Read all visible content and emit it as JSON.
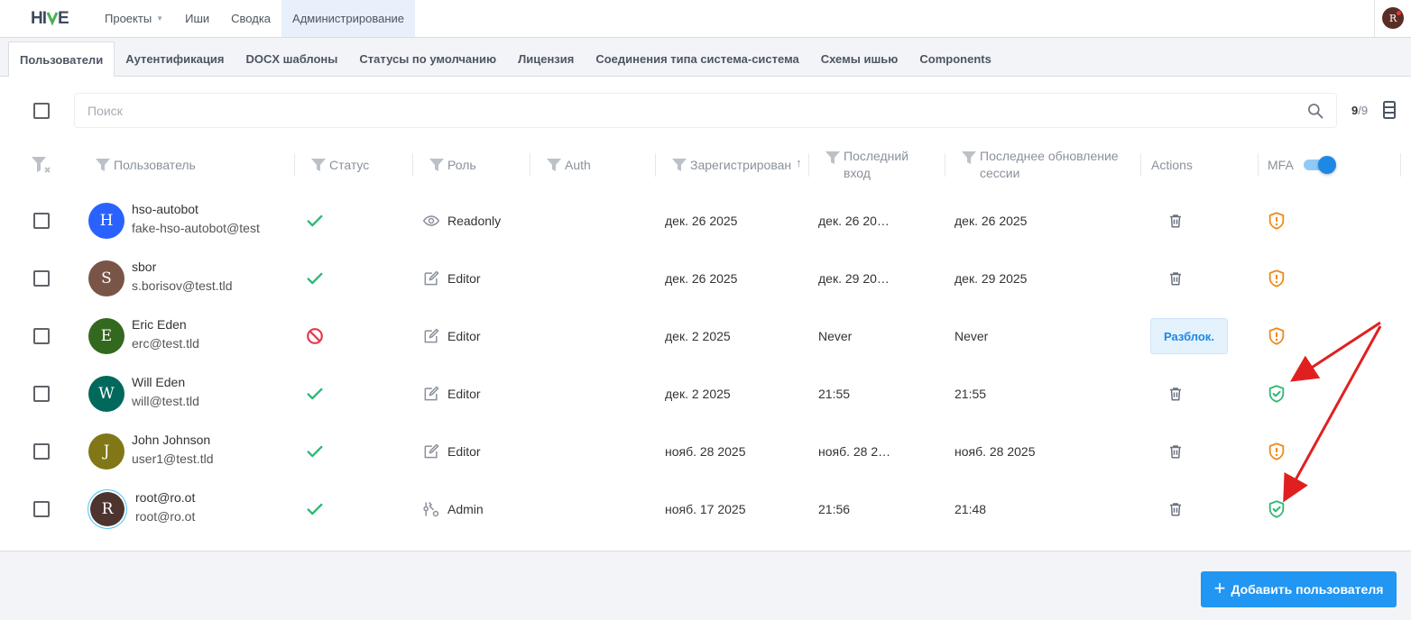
{
  "app": {
    "logo_text": "HIVE"
  },
  "nav": [
    {
      "label": "Проекты",
      "has_caret": true
    },
    {
      "label": "Иши"
    },
    {
      "label": "Сводка"
    },
    {
      "label": "Администрирование",
      "active": true
    }
  ],
  "current_user": {
    "initial": "R"
  },
  "subtabs": [
    {
      "label": "Пользователи",
      "active": true
    },
    {
      "label": "Аутентификация"
    },
    {
      "label": "DOCX шаблоны"
    },
    {
      "label": "Статусы по умолчанию"
    },
    {
      "label": "Лицензия"
    },
    {
      "label": "Соединения типа система-система"
    },
    {
      "label": "Схемы ишью"
    },
    {
      "label": "Components"
    }
  ],
  "search": {
    "placeholder": "Поиск",
    "value": ""
  },
  "count": {
    "shown": "9",
    "total": "/9"
  },
  "columns": {
    "user": "Пользователь",
    "status": "Статус",
    "role": "Роль",
    "auth": "Auth",
    "registered": "Зарегистрирован",
    "registered_sort": "↑",
    "last_login_1": "Последний",
    "last_login_2": "вход",
    "session_1": "Последнее обновление",
    "session_2": "сессии",
    "actions": "Actions",
    "mfa": "MFA"
  },
  "mfa_toggle": {
    "on": true
  },
  "users": [
    {
      "initial": "H",
      "avatar_color": "#2962ff",
      "name": "hso-autobot",
      "email": "fake-hso-autobot@test",
      "status": "active",
      "role_icon": "eye-icon",
      "role": "Readonly",
      "registered": "дек. 26 2025",
      "last_login": "дек. 26 20…",
      "session": "дек. 26 2025",
      "action": "delete",
      "mfa": "warning"
    },
    {
      "initial": "S",
      "avatar_color": "#795548",
      "name": "sbor",
      "email": "s.borisov@test.tld",
      "status": "active",
      "role_icon": "edit-icon",
      "role": "Editor",
      "registered": "дек. 26 2025",
      "last_login": "дек. 29 20…",
      "session": "дек. 29 2025",
      "action": "delete",
      "mfa": "warning"
    },
    {
      "initial": "E",
      "avatar_color": "#33691e",
      "name": "Eric Eden",
      "email": "erc@test.tld",
      "status": "blocked",
      "role_icon": "edit-icon",
      "role": "Editor",
      "registered": "дек. 2 2025",
      "last_login": "Never",
      "session": "Never",
      "action": "unlock",
      "action_label": "Разблок.",
      "mfa": "warning"
    },
    {
      "initial": "W",
      "avatar_color": "#00695c",
      "name": "Will Eden",
      "email": "will@test.tld",
      "status": "active",
      "role_icon": "edit-icon",
      "role": "Editor",
      "registered": "дек. 2 2025",
      "last_login": "21:55",
      "session": "21:55",
      "action": "delete",
      "mfa": "ok"
    },
    {
      "initial": "J",
      "avatar_color": "#827717",
      "name": "John Johnson",
      "email": "user1@test.tld",
      "status": "active",
      "role_icon": "edit-icon",
      "role": "Editor",
      "registered": "нояб. 28 2025",
      "last_login": "нояб. 28 2…",
      "session": "нояб. 28 2025",
      "action": "delete",
      "mfa": "warning"
    },
    {
      "initial": "R",
      "avatar_color": "#4e342e",
      "name": "root@ro.ot",
      "email": "root@ro.ot",
      "status": "active",
      "role_icon": "admin-icon",
      "role": "Admin",
      "registered": "нояб. 17 2025",
      "last_login": "21:56",
      "session": "21:48",
      "action": "delete",
      "mfa": "ok",
      "ring": true
    }
  ],
  "footer": {
    "add_user_label": "Добавить пользователя"
  },
  "colors": {
    "accent": "#2196f3",
    "ok": "#2eb872",
    "warning": "#ef8a1a",
    "blocked": "#e53950",
    "annotation": "#e02020"
  }
}
